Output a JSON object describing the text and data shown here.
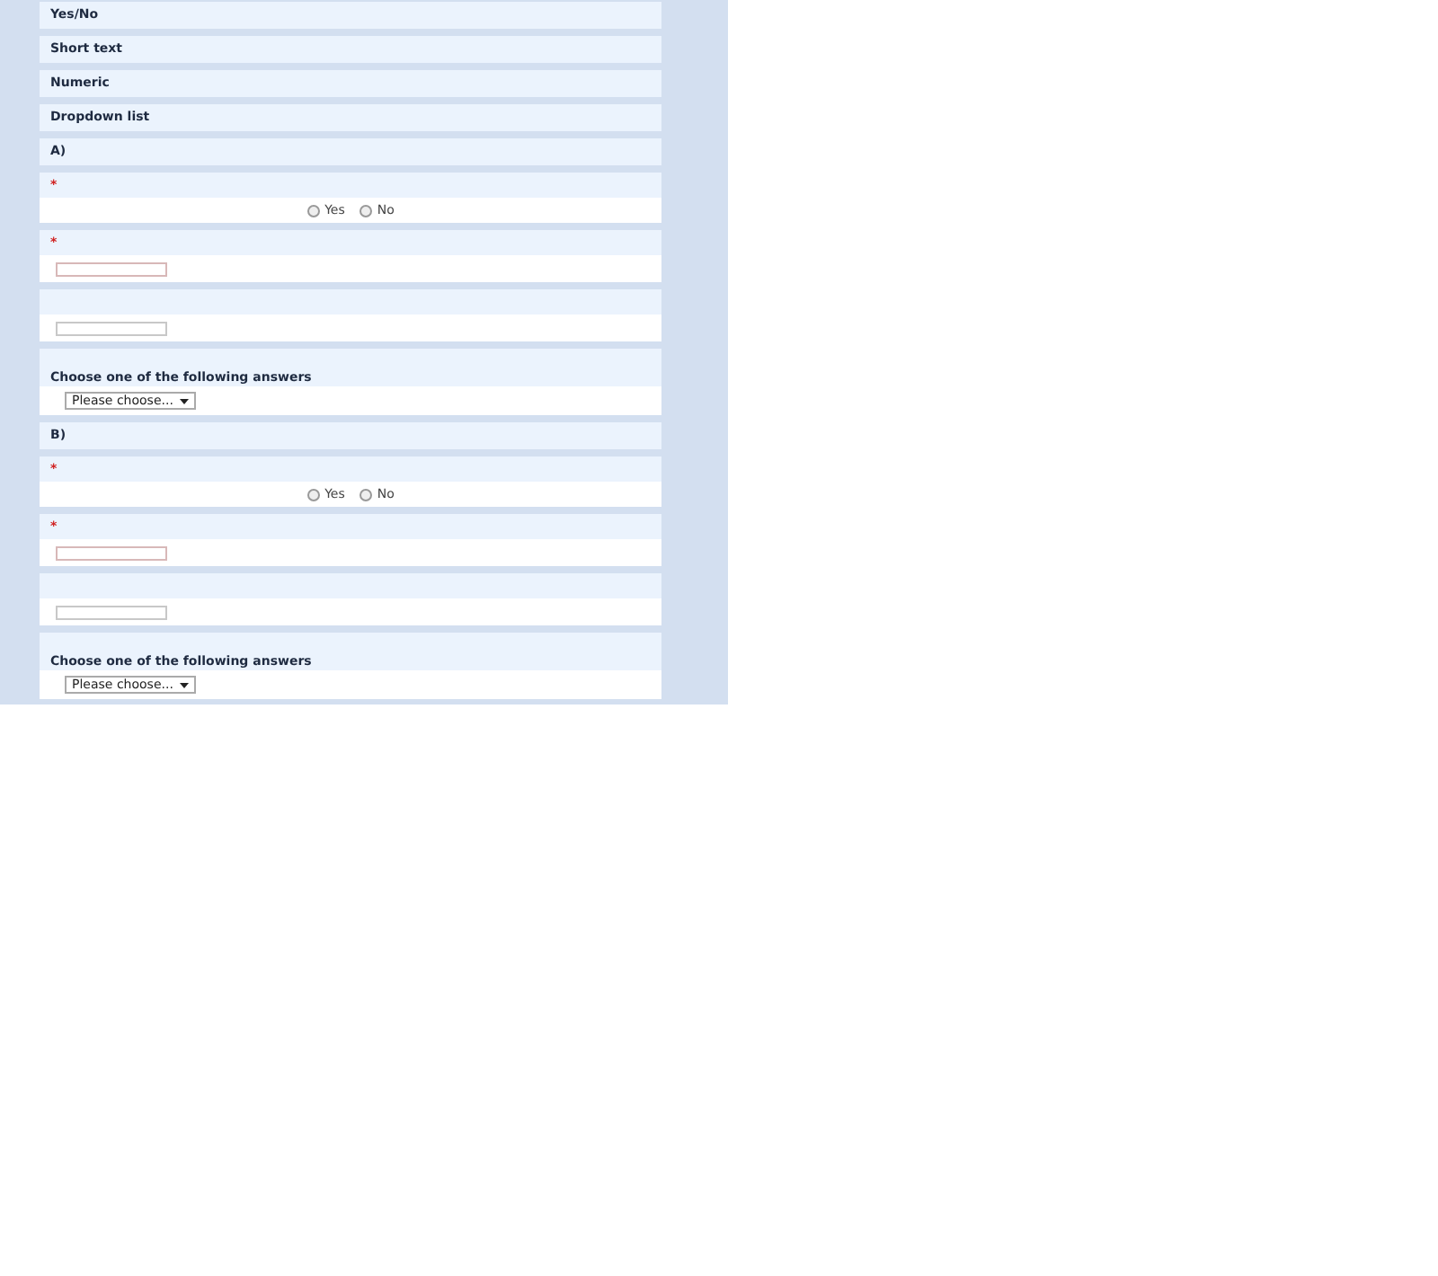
{
  "headings": [
    {
      "label": "Yes/No"
    },
    {
      "label": "Short text"
    },
    {
      "label": "Numeric"
    },
    {
      "label": "Dropdown list"
    }
  ],
  "sections": [
    {
      "label": "A)",
      "questions": [
        {
          "kind": "yesno",
          "mark": "*",
          "options": [
            {
              "label": "Yes",
              "checked": false
            },
            {
              "label": "No",
              "checked": false
            }
          ]
        },
        {
          "kind": "text",
          "mark": "*"
        },
        {
          "kind": "text"
        },
        {
          "kind": "dropdown",
          "label": "Choose one of the following answers",
          "placeholder": "Please choose..."
        }
      ]
    },
    {
      "label": "B)",
      "questions": [
        {
          "kind": "yesno",
          "mark": "*",
          "options": [
            {
              "label": "Yes",
              "checked": false
            },
            {
              "label": "No",
              "checked": false
            }
          ]
        },
        {
          "kind": "text",
          "mark": "*"
        },
        {
          "kind": "text"
        },
        {
          "kind": "dropdown",
          "label": "Choose one of the following answers",
          "placeholder": "Please choose..."
        }
      ]
    }
  ]
}
